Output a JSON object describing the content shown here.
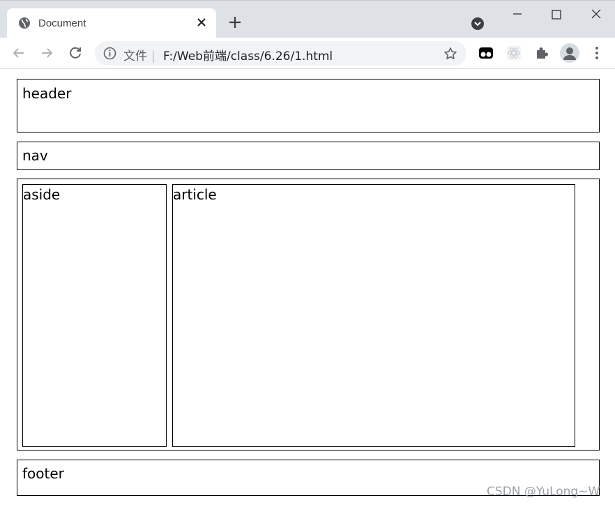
{
  "browser": {
    "tab": {
      "title": "Document",
      "favicon": "globe-icon"
    },
    "address_bar": {
      "scheme_label": "文件",
      "url": "F:/Web前端/class/6.26/1.html"
    }
  },
  "page": {
    "header": "header",
    "nav": "nav",
    "aside": "aside",
    "article": "article",
    "footer": "footer"
  },
  "watermark": "CSDN @YuLong~W",
  "colors": {
    "tabstrip": "#dee1e6",
    "omnibox": "#f1f3f4",
    "border": "#000000"
  }
}
